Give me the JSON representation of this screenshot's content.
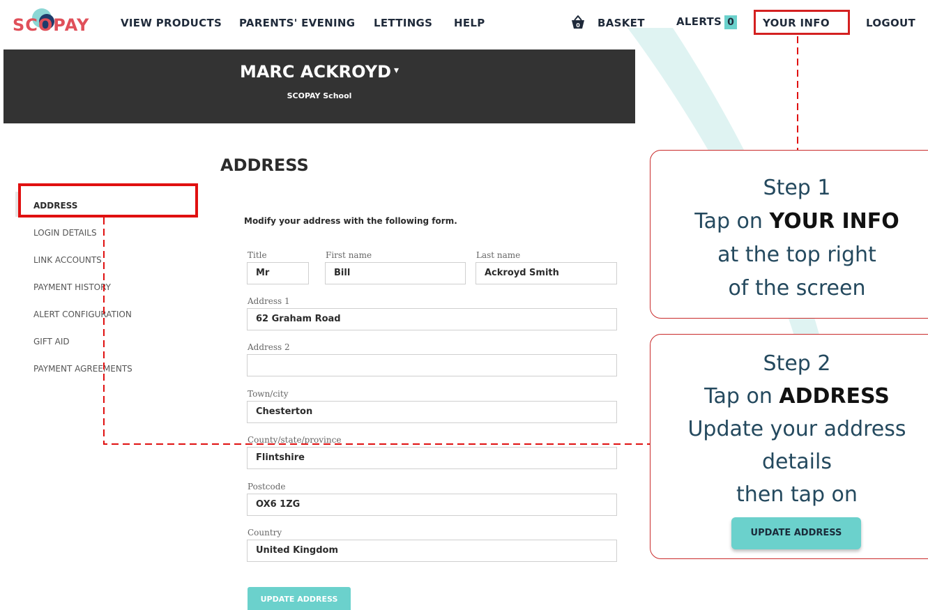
{
  "nav": {
    "logo": "SCOPAY",
    "view_products": "VIEW PRODUCTS",
    "parents_evening": "PARENTS' EVENING",
    "lettings": "LETTINGS",
    "help": "HELP",
    "basket": "BASKET",
    "alerts": "ALERTS",
    "alerts_count": "0",
    "your_info": "YOUR INFO",
    "logout": "LOGOUT"
  },
  "header": {
    "name": "MARC ACKROYD",
    "caret": "▾",
    "school": "SCOPAY School"
  },
  "page": {
    "title": "ADDRESS",
    "intro": "Modify your address with the following form."
  },
  "sidebar": {
    "items": [
      {
        "label": "ADDRESS"
      },
      {
        "label": "LOGIN DETAILS"
      },
      {
        "label": "LINK ACCOUNTS"
      },
      {
        "label": "PAYMENT HISTORY"
      },
      {
        "label": "ALERT CONFIGURATION"
      },
      {
        "label": "GIFT AID"
      },
      {
        "label": "PAYMENT AGREEMENTS"
      }
    ]
  },
  "form": {
    "title_label": "Title",
    "title_value": "Mr",
    "first_name_label": "First name",
    "first_name_value": "Bill",
    "last_name_label": "Last name",
    "last_name_value": "Ackroyd Smith",
    "address1_label": "Address 1",
    "address1_value": "62 Graham Road",
    "address2_label": "Address 2",
    "address2_value": "",
    "town_label": "Town/city",
    "town_value": "Chesterton",
    "county_label": "County/state/province",
    "county_value": "Flintshire",
    "postcode_label": "Postcode",
    "postcode_value": "OX6 1ZG",
    "country_label": "Country",
    "country_value": "United Kingdom",
    "submit_label": "UPDATE ADDRESS"
  },
  "callouts": {
    "step1": {
      "heading": "Step 1",
      "line1_pre": "Tap on ",
      "line1_bold": "YOUR INFO",
      "line2": "at the top right",
      "line3": "of the screen"
    },
    "step2": {
      "heading": "Step 2",
      "line1_pre": "Tap on ",
      "line1_bold": "ADDRESS",
      "line2": "Update your address",
      "line3": "details",
      "line4": "then tap on",
      "button": "UPDATE ADDRESS"
    }
  },
  "colors": {
    "accent": "#6bd1cc",
    "highlight_red": "#e01010",
    "header_bg": "#333333",
    "callout_text": "#24495e"
  }
}
